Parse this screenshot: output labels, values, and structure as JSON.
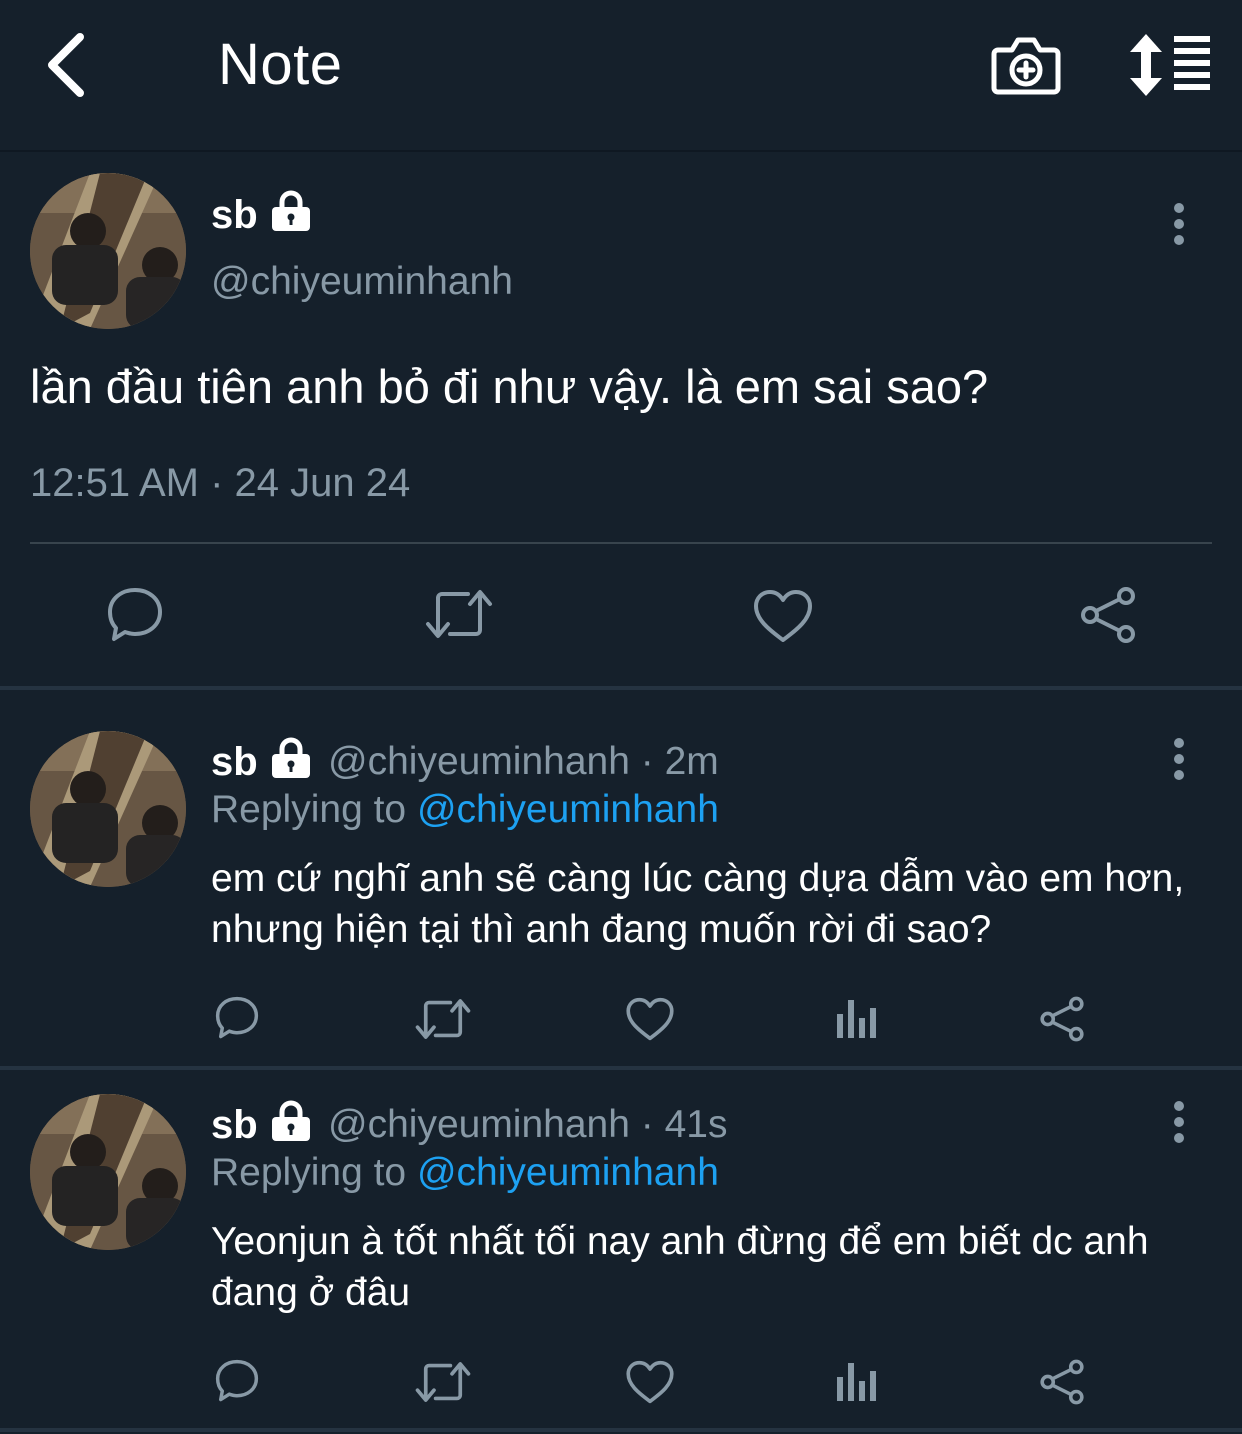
{
  "header": {
    "title": "Note"
  },
  "main_tweet": {
    "name": "sb",
    "handle": "@chiyeuminhanh",
    "text": "lần đầu tiên anh bỏ đi như vậy. là em sai sao?",
    "timestamp": "12:51 AM · 24 Jun 24"
  },
  "replies": [
    {
      "name": "sb",
      "handle_time": "@chiyeuminhanh · 2m",
      "replying_prefix": "Replying to ",
      "replying_to": "@chiyeuminhanh",
      "text": "em cứ nghĩ anh sẽ càng lúc càng dựa dẫm vào em hơn, nhưng hiện tại thì anh đang muốn rời đi sao?"
    },
    {
      "name": "sb",
      "handle_time": "@chiyeuminhanh · 41s",
      "replying_prefix": "Replying to ",
      "replying_to": "@chiyeuminhanh",
      "text": "Yeonjun à tốt nhất tối nay anh đừng để em biết dc anh đang ở đâu"
    }
  ],
  "icons": {
    "back": "back-arrow-icon",
    "camera": "camera-plus-icon",
    "sort": "sort-icon",
    "lock": "lock-icon",
    "more": "more-vertical-icon",
    "reply": "reply-icon",
    "retweet": "retweet-icon",
    "like": "heart-icon",
    "analytics": "analytics-icon",
    "share": "share-icon"
  },
  "colors": {
    "background": "#15202b",
    "secondary_text": "#8899a6",
    "link": "#1da1f2"
  }
}
